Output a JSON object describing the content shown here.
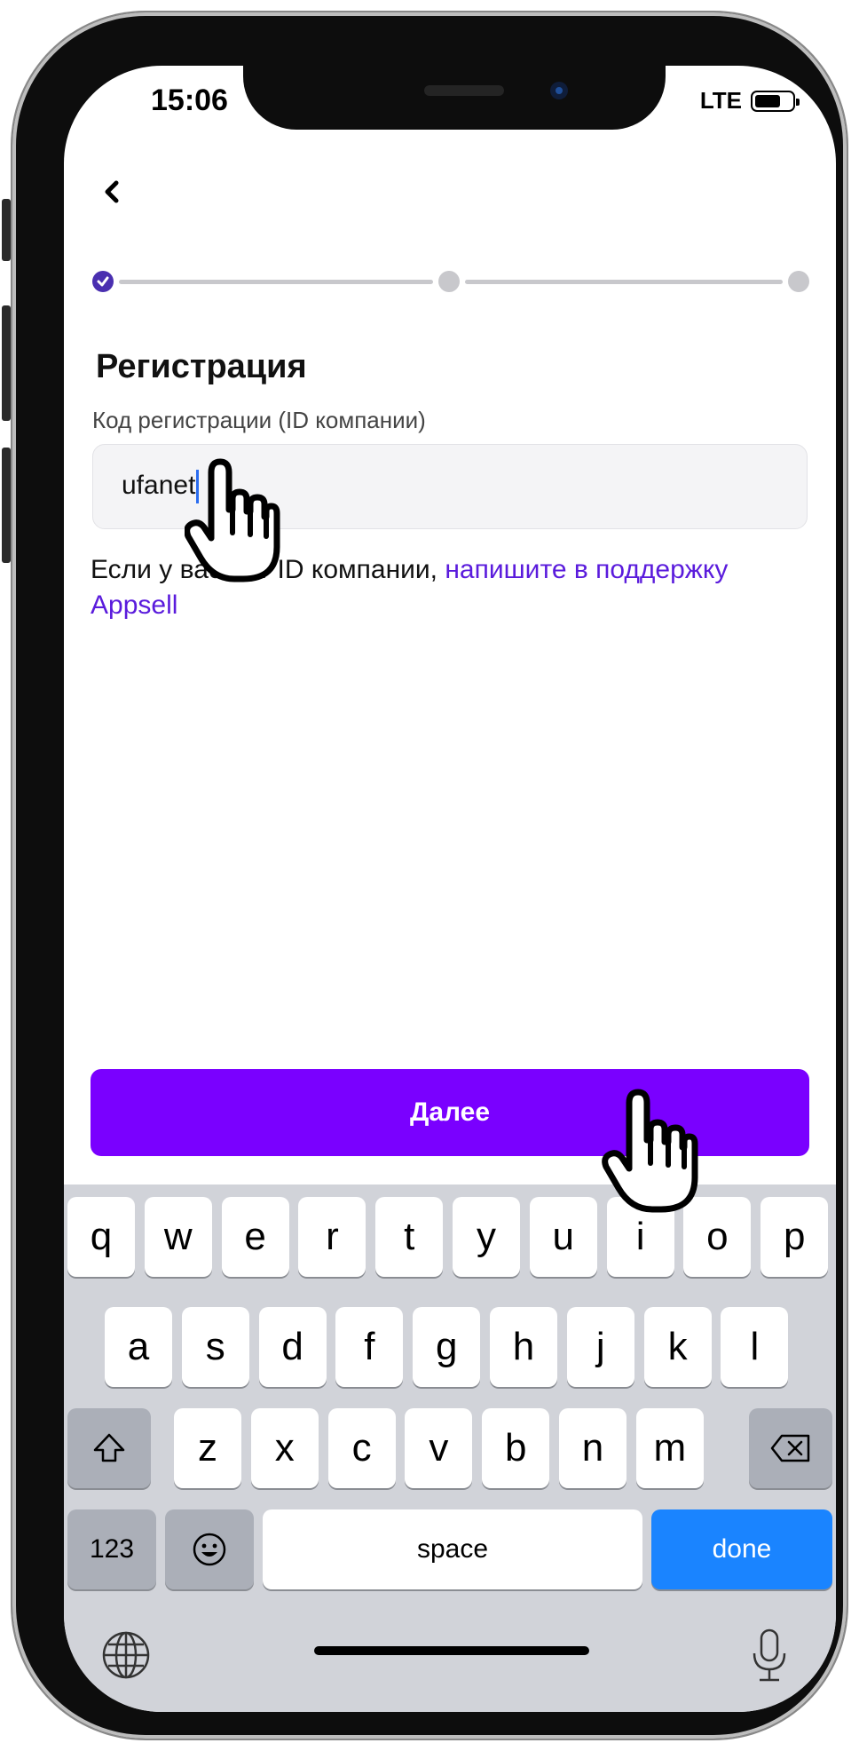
{
  "status_bar": {
    "time": "15:06",
    "network": "LTE",
    "battery_level": 0.7
  },
  "stepper": {
    "total_steps": 3,
    "completed_steps": 1
  },
  "page": {
    "title": "Регистрация",
    "field_label": "Код регистрации (ID компании)",
    "field_value": "ufanet",
    "hint_text": "Если у вас нет ID компании, ",
    "hint_link": "напишите в поддержку Appsell"
  },
  "buttons": {
    "next": "Далее"
  },
  "keyboard": {
    "row1": [
      "q",
      "w",
      "e",
      "r",
      "t",
      "y",
      "u",
      "i",
      "o",
      "p"
    ],
    "row2": [
      "a",
      "s",
      "d",
      "f",
      "g",
      "h",
      "j",
      "k",
      "l"
    ],
    "row3": [
      "z",
      "x",
      "c",
      "v",
      "b",
      "n",
      "m"
    ],
    "numbers_key": "123",
    "space_key": "space",
    "done_key": "done"
  },
  "colors": {
    "accent": "#7a00ff",
    "link": "#5a1bdc",
    "step_done": "#4a2fb0",
    "done_key": "#1a84ff"
  }
}
